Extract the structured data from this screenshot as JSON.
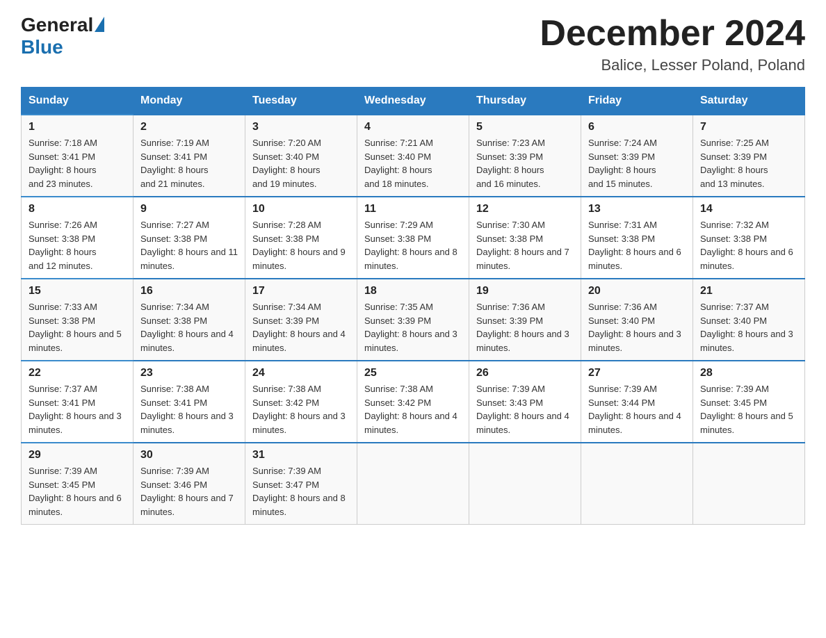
{
  "header": {
    "logo": {
      "general": "General",
      "blue": "Blue"
    },
    "title": "December 2024",
    "location": "Balice, Lesser Poland, Poland"
  },
  "days_of_week": [
    "Sunday",
    "Monday",
    "Tuesday",
    "Wednesday",
    "Thursday",
    "Friday",
    "Saturday"
  ],
  "weeks": [
    [
      {
        "day": "1",
        "sunrise": "7:18 AM",
        "sunset": "3:41 PM",
        "daylight": "8 hours and 23 minutes."
      },
      {
        "day": "2",
        "sunrise": "7:19 AM",
        "sunset": "3:41 PM",
        "daylight": "8 hours and 21 minutes."
      },
      {
        "day": "3",
        "sunrise": "7:20 AM",
        "sunset": "3:40 PM",
        "daylight": "8 hours and 19 minutes."
      },
      {
        "day": "4",
        "sunrise": "7:21 AM",
        "sunset": "3:40 PM",
        "daylight": "8 hours and 18 minutes."
      },
      {
        "day": "5",
        "sunrise": "7:23 AM",
        "sunset": "3:39 PM",
        "daylight": "8 hours and 16 minutes."
      },
      {
        "day": "6",
        "sunrise": "7:24 AM",
        "sunset": "3:39 PM",
        "daylight": "8 hours and 15 minutes."
      },
      {
        "day": "7",
        "sunrise": "7:25 AM",
        "sunset": "3:39 PM",
        "daylight": "8 hours and 13 minutes."
      }
    ],
    [
      {
        "day": "8",
        "sunrise": "7:26 AM",
        "sunset": "3:38 PM",
        "daylight": "8 hours and 12 minutes."
      },
      {
        "day": "9",
        "sunrise": "7:27 AM",
        "sunset": "3:38 PM",
        "daylight": "8 hours and 11 minutes."
      },
      {
        "day": "10",
        "sunrise": "7:28 AM",
        "sunset": "3:38 PM",
        "daylight": "8 hours and 9 minutes."
      },
      {
        "day": "11",
        "sunrise": "7:29 AM",
        "sunset": "3:38 PM",
        "daylight": "8 hours and 8 minutes."
      },
      {
        "day": "12",
        "sunrise": "7:30 AM",
        "sunset": "3:38 PM",
        "daylight": "8 hours and 7 minutes."
      },
      {
        "day": "13",
        "sunrise": "7:31 AM",
        "sunset": "3:38 PM",
        "daylight": "8 hours and 6 minutes."
      },
      {
        "day": "14",
        "sunrise": "7:32 AM",
        "sunset": "3:38 PM",
        "daylight": "8 hours and 6 minutes."
      }
    ],
    [
      {
        "day": "15",
        "sunrise": "7:33 AM",
        "sunset": "3:38 PM",
        "daylight": "8 hours and 5 minutes."
      },
      {
        "day": "16",
        "sunrise": "7:34 AM",
        "sunset": "3:38 PM",
        "daylight": "8 hours and 4 minutes."
      },
      {
        "day": "17",
        "sunrise": "7:34 AM",
        "sunset": "3:39 PM",
        "daylight": "8 hours and 4 minutes."
      },
      {
        "day": "18",
        "sunrise": "7:35 AM",
        "sunset": "3:39 PM",
        "daylight": "8 hours and 3 minutes."
      },
      {
        "day": "19",
        "sunrise": "7:36 AM",
        "sunset": "3:39 PM",
        "daylight": "8 hours and 3 minutes."
      },
      {
        "day": "20",
        "sunrise": "7:36 AM",
        "sunset": "3:40 PM",
        "daylight": "8 hours and 3 minutes."
      },
      {
        "day": "21",
        "sunrise": "7:37 AM",
        "sunset": "3:40 PM",
        "daylight": "8 hours and 3 minutes."
      }
    ],
    [
      {
        "day": "22",
        "sunrise": "7:37 AM",
        "sunset": "3:41 PM",
        "daylight": "8 hours and 3 minutes."
      },
      {
        "day": "23",
        "sunrise": "7:38 AM",
        "sunset": "3:41 PM",
        "daylight": "8 hours and 3 minutes."
      },
      {
        "day": "24",
        "sunrise": "7:38 AM",
        "sunset": "3:42 PM",
        "daylight": "8 hours and 3 minutes."
      },
      {
        "day": "25",
        "sunrise": "7:38 AM",
        "sunset": "3:42 PM",
        "daylight": "8 hours and 4 minutes."
      },
      {
        "day": "26",
        "sunrise": "7:39 AM",
        "sunset": "3:43 PM",
        "daylight": "8 hours and 4 minutes."
      },
      {
        "day": "27",
        "sunrise": "7:39 AM",
        "sunset": "3:44 PM",
        "daylight": "8 hours and 4 minutes."
      },
      {
        "day": "28",
        "sunrise": "7:39 AM",
        "sunset": "3:45 PM",
        "daylight": "8 hours and 5 minutes."
      }
    ],
    [
      {
        "day": "29",
        "sunrise": "7:39 AM",
        "sunset": "3:45 PM",
        "daylight": "8 hours and 6 minutes."
      },
      {
        "day": "30",
        "sunrise": "7:39 AM",
        "sunset": "3:46 PM",
        "daylight": "8 hours and 7 minutes."
      },
      {
        "day": "31",
        "sunrise": "7:39 AM",
        "sunset": "3:47 PM",
        "daylight": "8 hours and 8 minutes."
      },
      null,
      null,
      null,
      null
    ]
  ]
}
